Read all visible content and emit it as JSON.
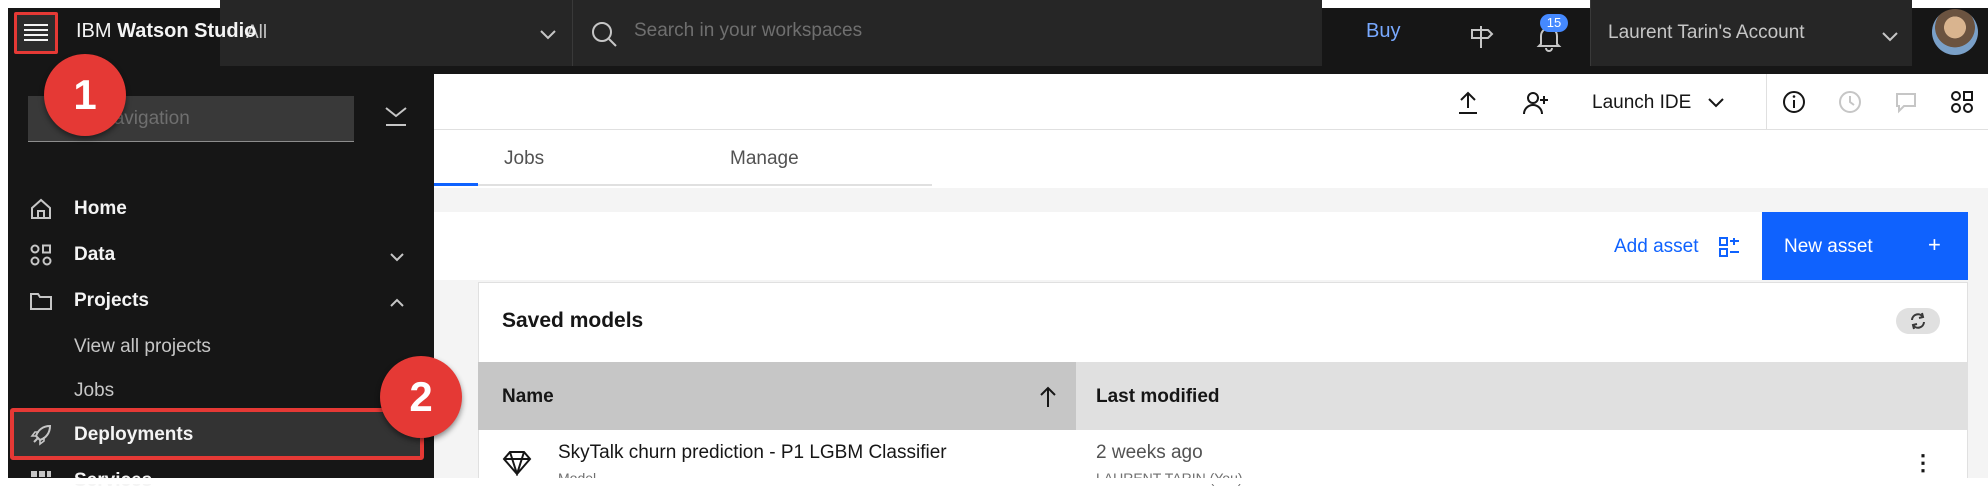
{
  "topbar": {
    "brand_prefix": "IBM",
    "brand_product": "Watson Studio",
    "scope": "All",
    "search_placeholder": "Search in your workspaces",
    "buy": "Buy",
    "notification_count": "15",
    "account": "Laurent Tarin's Account"
  },
  "toolbar": {
    "launch_ide": "Launch IDE"
  },
  "tabs": [
    {
      "label": "Jobs"
    },
    {
      "label": "Manage"
    }
  ],
  "assets": {
    "add_asset": "Add asset",
    "new_asset": "New asset",
    "plus": "+"
  },
  "panel": {
    "title": "Saved models",
    "columns": {
      "name": "Name",
      "last_modified": "Last modified"
    },
    "rows": [
      {
        "name": "SkyTalk churn prediction - P1 LGBM Classifier",
        "type": "Model",
        "last_modified": "2 weeks ago",
        "modified_by": "LAURENT TARIN (You)"
      }
    ]
  },
  "leftnav": {
    "filter_placeholder": "Navigation",
    "items": [
      {
        "label": "Home"
      },
      {
        "label": "Data"
      },
      {
        "label": "Projects"
      },
      {
        "label": "View all projects"
      },
      {
        "label": "Jobs"
      },
      {
        "label": "Deployments"
      },
      {
        "label": "Services"
      }
    ]
  },
  "markers": {
    "first": "1",
    "second": "2"
  },
  "colors": {
    "accent": "#0f62fe",
    "highlight": "#e53935",
    "shell": "#161616"
  }
}
